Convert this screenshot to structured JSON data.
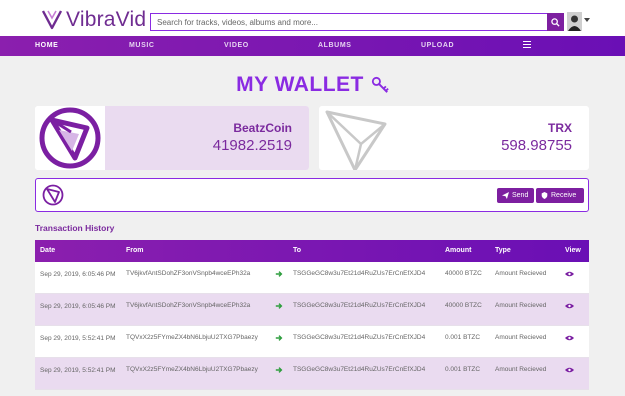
{
  "brand": {
    "name": "VibraVid"
  },
  "search": {
    "placeholder": "Search for tracks, videos, albums and more..."
  },
  "nav": {
    "items": [
      "HOME",
      "MUSIC",
      "VIDEO",
      "ALBUMS",
      "UPLOAD"
    ],
    "active": "HOME"
  },
  "page": {
    "title": "MY WALLET"
  },
  "wallets": [
    {
      "name": "BeatzCoin",
      "value": "41982.2519"
    },
    {
      "name": "TRX",
      "value": "598.98755"
    }
  ],
  "actions": {
    "send_label": "Send",
    "receive_label": "Receive"
  },
  "history": {
    "title": "Transaction History",
    "columns": [
      "Date",
      "From",
      "To",
      "Amount",
      "Type",
      "View"
    ],
    "rows": [
      {
        "date": "Sep 29, 2019, 6:05:46 PM",
        "from": "TV6jkvfAntSDohZF3onVSnpb4wceEPh32a",
        "to": "TSGGeGC8w3u7Et21d4RuZUs7ErCnEfXJD4",
        "amount": "40000 BTZC",
        "type": "Amount Recieved"
      },
      {
        "date": "Sep 29, 2019, 6:05:46 PM",
        "from": "TV6jkvfAntSDohZF3onVSnpb4wceEPh32a",
        "to": "TSGGeGC8w3u7Et21d4RuZUs7ErCnEfXJD4",
        "amount": "40000 BTZC",
        "type": "Amount Recieved"
      },
      {
        "date": "Sep 29, 2019, 5:52:41 PM",
        "from": "TQVxX2z5FYmeZX4bN6LbjuU2TXG7Pbaezy",
        "to": "TSGGeGC8w3u7Et21d4RuZUs7ErCnEfXJD4",
        "amount": "0.001 BTZC",
        "type": "Amount Recieved"
      },
      {
        "date": "Sep 29, 2019, 5:52:41 PM",
        "from": "TQVxX2z5FYmeZX4bN6LbjuU2TXG7Pbaezy",
        "to": "TSGGeGC8w3u7Et21d4RuZUs7ErCnEfXJD4",
        "amount": "0.001 BTZC",
        "type": "Amount Recieved"
      }
    ]
  },
  "icons": {
    "brand": "logo-icon",
    "search": "search-icon",
    "key": "key-icon",
    "arrow": "arrow-right-icon",
    "view": "eye-icon",
    "menu": "menu-icon",
    "send": "paper-plane-icon",
    "receive": "shield-icon"
  },
  "colors": {
    "accent": "#8a2be2",
    "nav_start": "#8b1fae",
    "nav_end": "#6a0fb5",
    "brand_text": "#6f2c91"
  }
}
